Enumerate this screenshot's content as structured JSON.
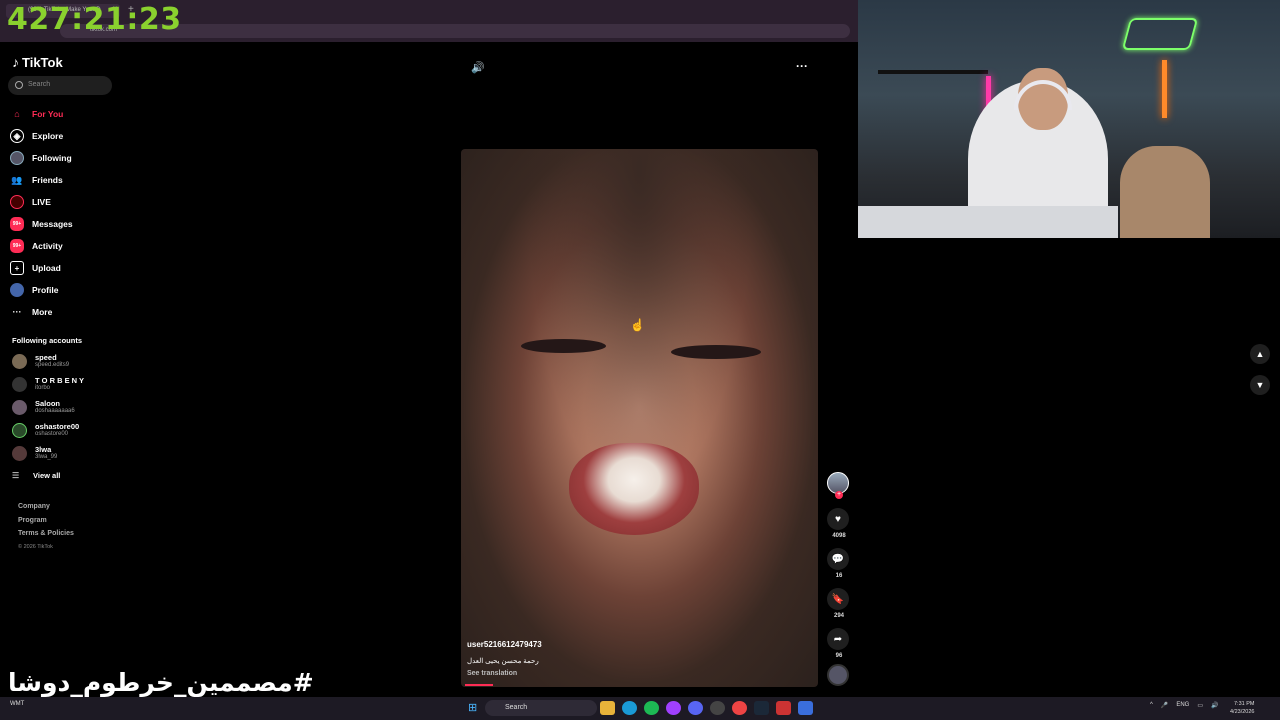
{
  "overlay": {
    "timer": "427:21:23",
    "hashtag": "#مصممين_خرطوم_دوشا"
  },
  "browser": {
    "tab_title": "(99+) TikTok - Make Your D",
    "url": "tiktok.com"
  },
  "sidebar": {
    "logo": "TikTok",
    "search_placeholder": "Search",
    "nav": [
      {
        "label": "For You",
        "icon": "home-icon"
      },
      {
        "label": "Explore",
        "icon": "compass-icon"
      },
      {
        "label": "Following",
        "icon": "following-icon"
      },
      {
        "label": "Friends",
        "icon": "friends-icon"
      },
      {
        "label": "LIVE",
        "icon": "live-icon"
      },
      {
        "label": "Messages",
        "icon": "messages-icon",
        "badge": "99+"
      },
      {
        "label": "Activity",
        "icon": "activity-icon",
        "badge": "99+"
      },
      {
        "label": "Upload",
        "icon": "upload-icon"
      },
      {
        "label": "Profile",
        "icon": "profile-icon"
      },
      {
        "label": "More",
        "icon": "more-icon"
      }
    ],
    "following_title": "Following accounts",
    "accounts": [
      {
        "name": "speed",
        "handle": "speed.edits9"
      },
      {
        "name": "T O R B E N Y",
        "handle": "itorbo"
      },
      {
        "name": "Saloon",
        "handle": "doshaaaaaaa6"
      },
      {
        "name": "oshastore00",
        "handle": "oshastore00"
      },
      {
        "name": "3lwa",
        "handle": "3lwa_99"
      }
    ],
    "view_all": "View all",
    "footer": [
      "Company",
      "Program",
      "Terms & Policies"
    ],
    "copyright": "© 2026 TikTok"
  },
  "video": {
    "username": "user5216612479473",
    "description": "رحمة محسن يحيى العدل",
    "translate": "See translation",
    "likes": "4098",
    "comments": "16",
    "saves": "294",
    "shares": "96"
  },
  "taskbar": {
    "weather": "WMT",
    "search": "Search",
    "lang": "ENG",
    "time": "7:31 PM",
    "date": "4/23/2026"
  },
  "colors": {
    "accent": "#fe2c55",
    "timer": "#8ad12e"
  }
}
